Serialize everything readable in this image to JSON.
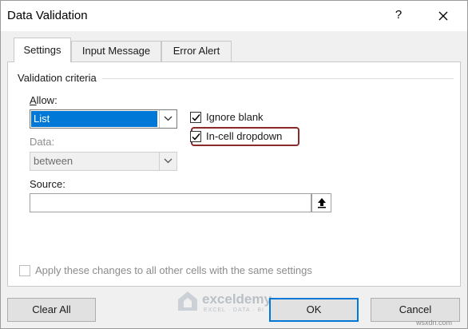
{
  "dialog": {
    "title": "Data Validation",
    "help_label": "?",
    "close_icon": "close-icon"
  },
  "tabs": [
    {
      "label": "Settings",
      "active": true
    },
    {
      "label": "Input Message",
      "active": false
    },
    {
      "label": "Error Alert",
      "active": false
    }
  ],
  "settings": {
    "group_label": "Validation criteria",
    "allow": {
      "label": "Allow:",
      "value": "List"
    },
    "data": {
      "label": "Data:",
      "value": "between",
      "disabled": true
    },
    "source": {
      "label": "Source:",
      "value": ""
    },
    "ignore_blank": {
      "label": "Ignore blank",
      "checked": true
    },
    "in_cell_dropdown": {
      "label": "In-cell dropdown",
      "checked": true,
      "highlight_color": "#8b2a2a"
    },
    "apply_all": {
      "label": "Apply these changes to all other cells with the same settings",
      "checked": false,
      "disabled": true
    }
  },
  "buttons": {
    "clear_all": "Clear All",
    "ok": "OK",
    "cancel": "Cancel"
  },
  "watermark": {
    "name": "exceldemy",
    "tagline": "EXCEL · DATA · BI",
    "site": "wsxdn.com"
  },
  "colors": {
    "selection": "#0078d7",
    "default_button_border": "#0078d7"
  }
}
